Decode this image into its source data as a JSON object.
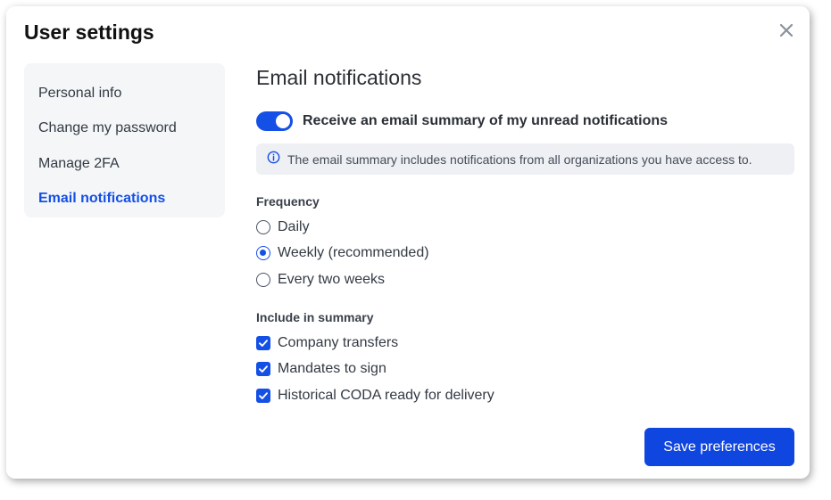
{
  "dialog": {
    "title": "User settings"
  },
  "sidebar": {
    "items": [
      {
        "label": "Personal info",
        "active": false
      },
      {
        "label": "Change my password",
        "active": false
      },
      {
        "label": "Manage 2FA",
        "active": false
      },
      {
        "label": "Email notifications",
        "active": true
      }
    ]
  },
  "main": {
    "section_title": "Email notifications",
    "summary_toggle": {
      "label": "Receive an email summary of my unread notifications",
      "enabled": true
    },
    "info": {
      "icon": "info-icon",
      "text": "The email summary includes notifications from all organizations you have access to."
    },
    "frequency": {
      "label": "Frequency",
      "options": [
        {
          "label": "Daily",
          "checked": false
        },
        {
          "label": "Weekly (recommended)",
          "checked": true
        },
        {
          "label": "Every two weeks",
          "checked": false
        }
      ]
    },
    "include": {
      "label": "Include in summary",
      "options": [
        {
          "label": "Company transfers",
          "checked": true
        },
        {
          "label": "Mandates to sign",
          "checked": true
        },
        {
          "label": "Historical CODA ready for delivery",
          "checked": true
        }
      ]
    },
    "save_label": "Save preferences"
  },
  "colors": {
    "accent": "#1450e6",
    "button": "#1046e0",
    "sidebar_bg": "#f5f6f8",
    "info_bg": "#eef0f4"
  }
}
